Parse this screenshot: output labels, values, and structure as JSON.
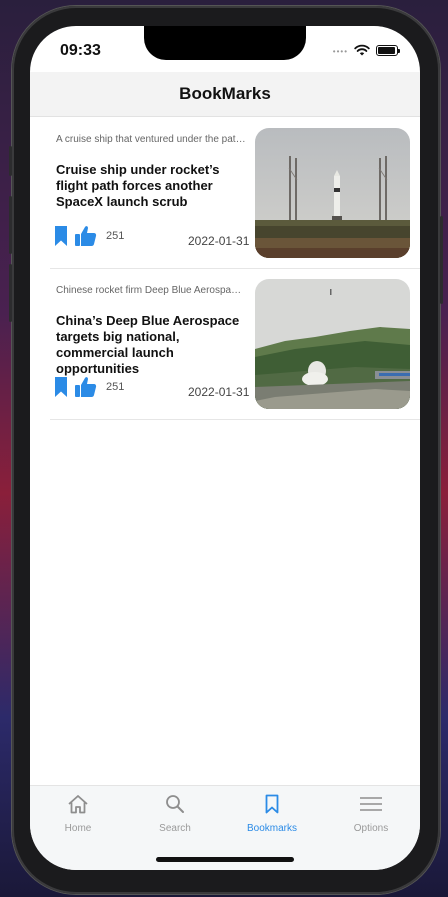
{
  "status_bar": {
    "time": "09:33"
  },
  "header": {
    "title": "BookMarks"
  },
  "colors": {
    "accent": "#2b8be6",
    "tab_inactive": "#9a9a9a"
  },
  "articles": [
    {
      "snippet": "A cruise ship that ventured under the path of a rocket launch forced SpaceX to scrub",
      "title": "Cruise ship under rocket’s flight path forces another SpaceX launch scrub",
      "likes": "251",
      "date": "2022-01-31",
      "image": "rocket-on-launch-pad"
    },
    {
      "snippet": "Chinese rocket firm Deep Blue Aerospace targets big national launch",
      "title": "China’s Deep Blue Aerospace targets big national, commercial launch opportunities",
      "likes": "251",
      "date": "2022-01-31",
      "image": "rocket-test-hillside"
    }
  ],
  "tabs": [
    {
      "label": "Home",
      "icon": "home-icon"
    },
    {
      "label": "Search",
      "icon": "search-icon"
    },
    {
      "label": "Bookmarks",
      "icon": "bookmark-icon",
      "active": true
    },
    {
      "label": "Options",
      "icon": "menu-icon"
    }
  ]
}
